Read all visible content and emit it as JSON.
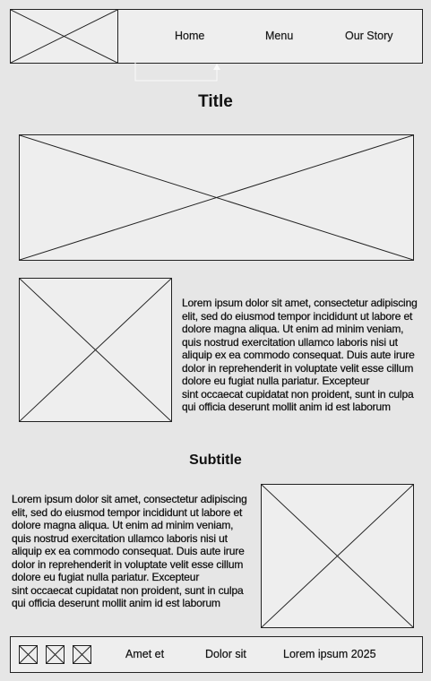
{
  "header": {
    "logo_icon": "image-placeholder-icon",
    "nav": [
      {
        "label": "Home"
      },
      {
        "label": "Menu"
      },
      {
        "label": "Our Story"
      }
    ]
  },
  "main": {
    "title": "Title",
    "subtitle": "Subtitle",
    "paragraph1_lines": [
      "Lorem ipsum dolor sit amet, consectetur adipiscing",
      "elit, sed do eiusmod tempor incididunt ut labore et",
      "dolore magna aliqua. Ut enim ad minim veniam,",
      "quis nostrud exercitation ullamco laboris nisi ut",
      "aliquip ex ea commodo consequat. Duis aute irure",
      "dolor in reprehenderit in voluptate velit esse cillum",
      "dolore eu fugiat nulla pariatur. Excepteur",
      "sint occaecat cupidatat non proident, sunt in culpa",
      "qui officia deserunt mollit anim id est laborum"
    ],
    "paragraph2_lines": [
      "Lorem ipsum dolor sit amet, consectetur adipiscing",
      "elit, sed do eiusmod tempor incididunt ut labore et",
      "dolore magna aliqua. Ut enim ad minim veniam,",
      "quis nostrud exercitation ullamco laboris nisi ut",
      "aliquip ex ea commodo consequat. Duis aute irure",
      "dolor in reprehenderit in voluptate velit esse cillum",
      "dolore eu fugiat nulla pariatur. Excepteur",
      "sint occaecat cupidatat non proident, sunt in culpa",
      "qui officia deserunt mollit anim id est laborum"
    ]
  },
  "footer": {
    "social_icons": [
      "image-placeholder-icon",
      "image-placeholder-icon",
      "image-placeholder-icon"
    ],
    "links": [
      {
        "label": "Amet et"
      },
      {
        "label": "Dolor sit"
      }
    ],
    "copyright": "Lorem ipsum 2025"
  },
  "colors": {
    "background": "#e6e6e6",
    "box": "#eeeeee",
    "stroke": "#222222"
  }
}
